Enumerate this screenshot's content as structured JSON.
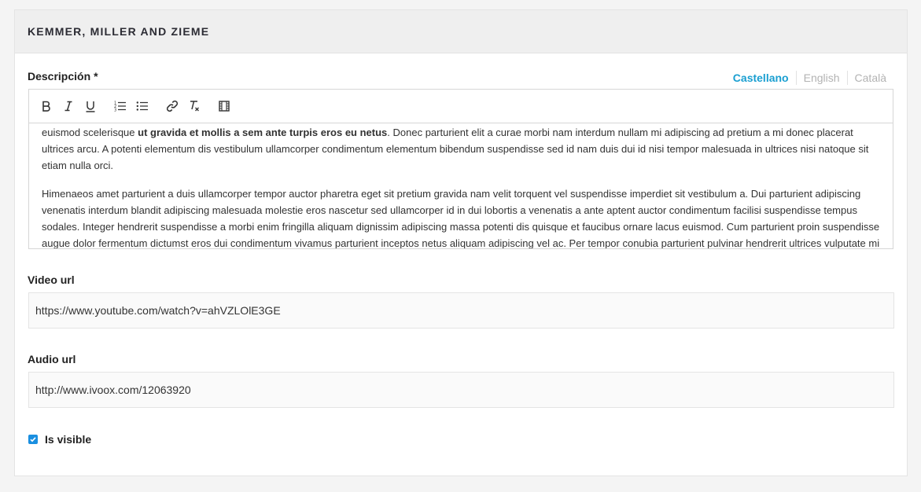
{
  "card": {
    "title": "KEMMER, MILLER AND ZIEME"
  },
  "description": {
    "label": "Descripción",
    "required_mark": "*",
    "languages": [
      "Castellano",
      "English",
      "Català"
    ],
    "active_language": "Castellano",
    "toolbar": {
      "bold_icon": "bold-icon",
      "italic_icon": "italic-icon",
      "underline_icon": "underline-icon",
      "ordered_list_icon": "ordered-list-icon",
      "bullet_list_icon": "bullet-list-icon",
      "link_icon": "link-icon",
      "clear_format_icon": "clear-format-icon",
      "video_icon": "video-icon"
    },
    "paragraph1": {
      "before_bold": "euismod scelerisque ",
      "bold": "ut gravida et mollis a sem ante turpis eros eu netus",
      "after_bold": ". Donec parturient elit a curae morbi nam interdum nullam mi adipiscing ad pretium a mi donec placerat ultrices arcu. A potenti elementum dis vestibulum ullamcorper condimentum elementum bibendum suspendisse sed id nam duis dui id nisi tempor malesuada in ultrices nisi natoque sit etiam nulla orci."
    },
    "paragraph2": "Himenaeos amet parturient a duis ullamcorper tempor auctor pharetra eget sit pretium gravida nam velit torquent vel suspendisse imperdiet sit vestibulum a. Dui parturient adipiscing venenatis interdum blandit adipiscing malesuada molestie eros nascetur sed ullamcorper id in dui lobortis a venenatis a ante aptent auctor condimentum facilisi suspendisse tempus sodales. Integer hendrerit suspendisse a morbi enim fringilla aliquam dignissim adipiscing massa potenti dis quisque et faucibus ornare lacus euismod. Cum parturient proin suspendisse augue dolor fermentum dictumst eros dui condimentum vivamus parturient inceptos netus aliquam adipiscing vel ac. Per tempor conubia parturient pulvinar hendrerit ultrices vulputate mi"
  },
  "video": {
    "label": "Video url",
    "value": "https://www.youtube.com/watch?v=ahVZLOlE3GE"
  },
  "audio": {
    "label": "Audio url",
    "value": "http://www.ivoox.com/12063920"
  },
  "visibility": {
    "label": "Is visible",
    "checked": true
  },
  "colors": {
    "accent": "#1a9fd1",
    "checkbox": "#1a8fe0"
  }
}
